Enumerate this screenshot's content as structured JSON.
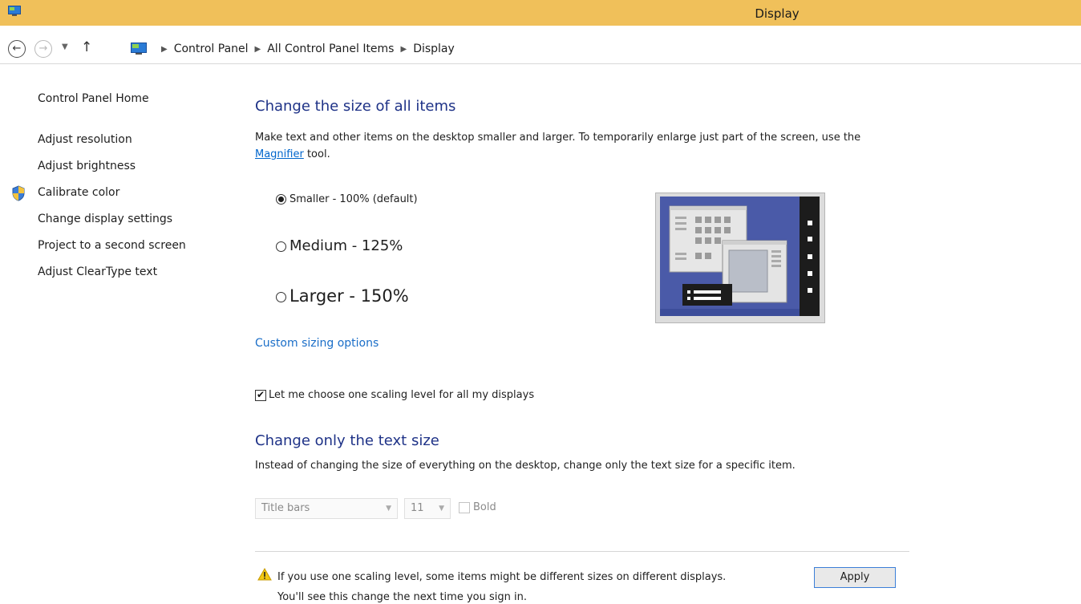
{
  "window": {
    "title": "Display",
    "icon": "display-monitor-icon",
    "accent": "#f0c05a"
  },
  "address": {
    "back": "back-arrow-icon",
    "forward": "forward-arrow-icon",
    "up": "up-arrow-icon",
    "crumbs": [
      "Control Panel",
      "All Control Panel Items",
      "Display"
    ]
  },
  "sidebar": {
    "home": "Control Panel Home",
    "items": [
      {
        "label": "Adjust resolution"
      },
      {
        "label": "Adjust brightness"
      },
      {
        "label": "Calibrate color",
        "icon": "uac-shield-icon"
      },
      {
        "label": "Change display settings"
      },
      {
        "label": "Project to a second screen"
      },
      {
        "label": "Adjust ClearType text"
      }
    ]
  },
  "main": {
    "heading_all": "Change the size of all items",
    "desc_all_pre": "Make text and other items on the desktop smaller and larger. To temporarily enlarge just part of the screen, use the ",
    "desc_all_link": "Magnifier",
    "desc_all_post": " tool.",
    "options": [
      {
        "label": "Smaller - 100% (default)",
        "selected": true
      },
      {
        "label": "Medium - 125%",
        "selected": false
      },
      {
        "label": "Larger - 150%",
        "selected": false
      }
    ],
    "custom_link": "Custom sizing options",
    "one_level_label": "Let me choose one scaling level for all my displays",
    "one_level_checked": true,
    "heading_text": "Change only the text size",
    "desc_text": "Instead of changing the size of everything on the desktop, change only the text size for a specific item.",
    "item_select": "Title bars",
    "size_select": "11",
    "bold_label": "Bold",
    "bold_checked": false,
    "warning_line1": "If you use one scaling level, some items might be different sizes on different displays.",
    "warning_line2": "You'll see this change the next time you sign in.",
    "apply_label": "Apply"
  }
}
